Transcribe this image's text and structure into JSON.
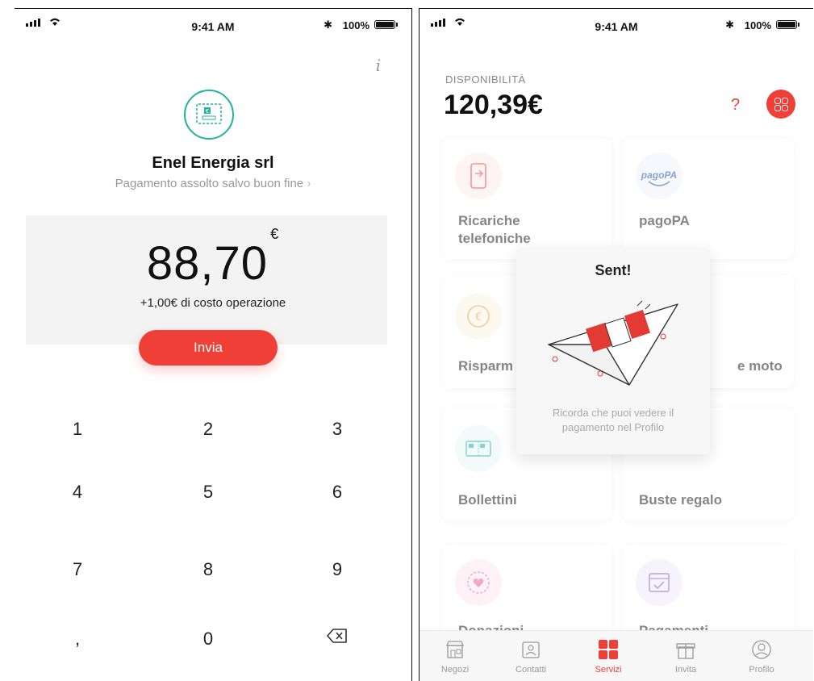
{
  "status_bar": {
    "time": "9:41 AM",
    "battery": "100%",
    "bluetooth": "✱"
  },
  "left": {
    "info_icon": "i",
    "merchant": {
      "name": "Enel Energia srl",
      "subtitle": "Pagamento assolto salvo buon fine",
      "subtitle_chevron": "›"
    },
    "amount": {
      "value": "88,70",
      "currency": "€",
      "fee": "+1,00€ di costo operazione"
    },
    "send_label": "Invia",
    "keypad": [
      "1",
      "2",
      "3",
      "4",
      "5",
      "6",
      "7",
      "8",
      "9",
      ",",
      "0"
    ]
  },
  "right": {
    "balance_label": "DISPONIBILITÀ",
    "balance_value": "120,39€",
    "help_icon": "?",
    "tiles": [
      {
        "label": "Ricariche telefoniche"
      },
      {
        "label": "pagoPA",
        "logo": "pagoPA"
      },
      {
        "label": "Risparm"
      },
      {
        "label": "e moto"
      },
      {
        "label": "Bollettini"
      },
      {
        "label": "Buste regalo"
      },
      {
        "label": "Donazioni"
      },
      {
        "label": "Pagamenti"
      }
    ],
    "modal": {
      "title": "Sent!",
      "message": "Ricorda che puoi vedere il pagamento nel Profilo"
    },
    "tabs": [
      {
        "label": "Negozi",
        "icon": "store-icon"
      },
      {
        "label": "Contatti",
        "icon": "contacts-icon"
      },
      {
        "label": "Servizi",
        "icon": "services-icon",
        "active": true
      },
      {
        "label": "Invita",
        "icon": "gift-icon"
      },
      {
        "label": "Profilo",
        "icon": "profile-icon"
      }
    ]
  },
  "colors": {
    "accent": "#ef3f36",
    "teal": "#20b3a1",
    "muted": "#999999"
  }
}
